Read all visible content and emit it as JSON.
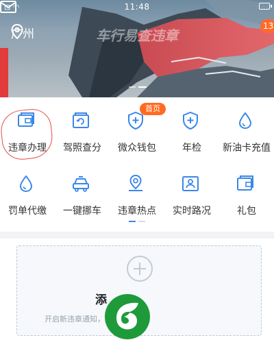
{
  "status_bar": {
    "time": "11:48",
    "signal": "⊡ ◠",
    "battery_icon": "battery-icon"
  },
  "header": {
    "city": "广州",
    "watermark": "车行易查违章",
    "message_badge": "13"
  },
  "banner": {
    "page_count": 2,
    "active_page": 2
  },
  "services": {
    "badge": "首页",
    "items": [
      {
        "label": "违章办理",
        "icon": "wallet-card-icon"
      },
      {
        "label": "驾照查分",
        "icon": "license-refresh-icon"
      },
      {
        "label": "微众钱包",
        "icon": "shield-plus-icon"
      },
      {
        "label": "年检",
        "icon": "shield-plus-icon"
      },
      {
        "label": "新油卡充值",
        "icon": "fuel-drop-icon"
      },
      {
        "label": "罚单代缴",
        "icon": "drop-icon"
      },
      {
        "label": "一键挪车",
        "icon": "car-icon"
      },
      {
        "label": "违章热点",
        "icon": "location-pin-icon"
      },
      {
        "label": "实时路况",
        "icon": "map-person-icon"
      },
      {
        "label": "礼包",
        "icon": "gift-wallet-icon"
      }
    ],
    "page_count": 2,
    "active_page": 1
  },
  "add_card": {
    "title": "添",
    "hint": "开启新违章通知，"
  },
  "colors": {
    "accent": "#3a87e8",
    "badge": "#ff6a2a",
    "tag": "#ff6b22"
  }
}
